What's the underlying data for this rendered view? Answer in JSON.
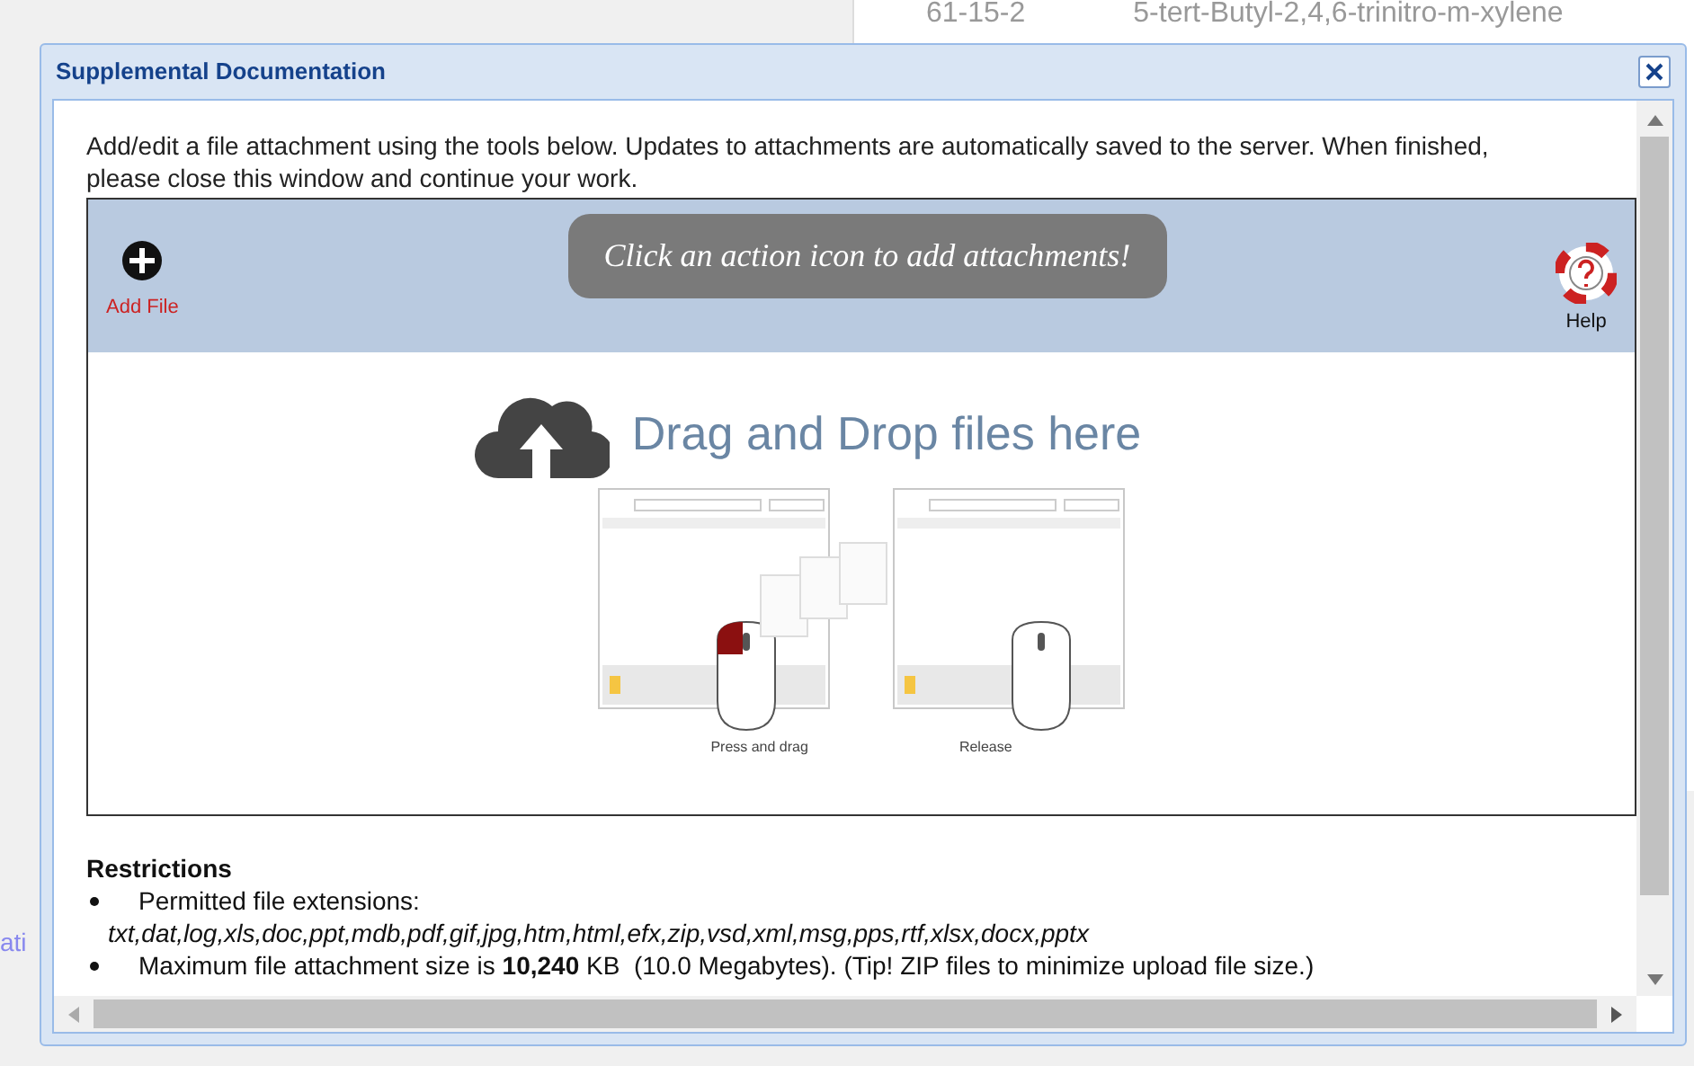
{
  "background": {
    "cells": [
      "61-15-2",
      "5-tert-Butyl-2,4,6-trinitro-m-xylene"
    ],
    "side_text": "ati"
  },
  "dialog": {
    "title": "Supplemental Documentation",
    "intro": "Add/edit a file attachment using the tools below. Updates to attachments are automatically saved to the server. When finished, please close this window and continue your work.",
    "toolbar": {
      "actions": [
        {
          "kind": "add",
          "label": "Add File"
        }
      ],
      "banner": "Click an action icon to add attachments!",
      "help": "Help"
    },
    "dropzone": {
      "heading": "Drag and Drop files here",
      "captions": [
        "Press and drag",
        "Release"
      ]
    },
    "restrictions": {
      "title": "Restrictions",
      "items": [
        {
          "kind": "list",
          "label": "Permitted file extensions:",
          "detail": "txt,dat,log,xls,doc,ppt,mdb,pdf,gif,jpg,htm,html,efx,zip,vsd,xml,msg,pps,rtf,xlsx,docx,pptx"
        },
        {
          "kind": "text",
          "text": "Maximum file attachment size is **10,240** KB  (10.0 Megabytes). (Tip! ZIP files to minimize upload file size.)"
        }
      ]
    }
  }
}
